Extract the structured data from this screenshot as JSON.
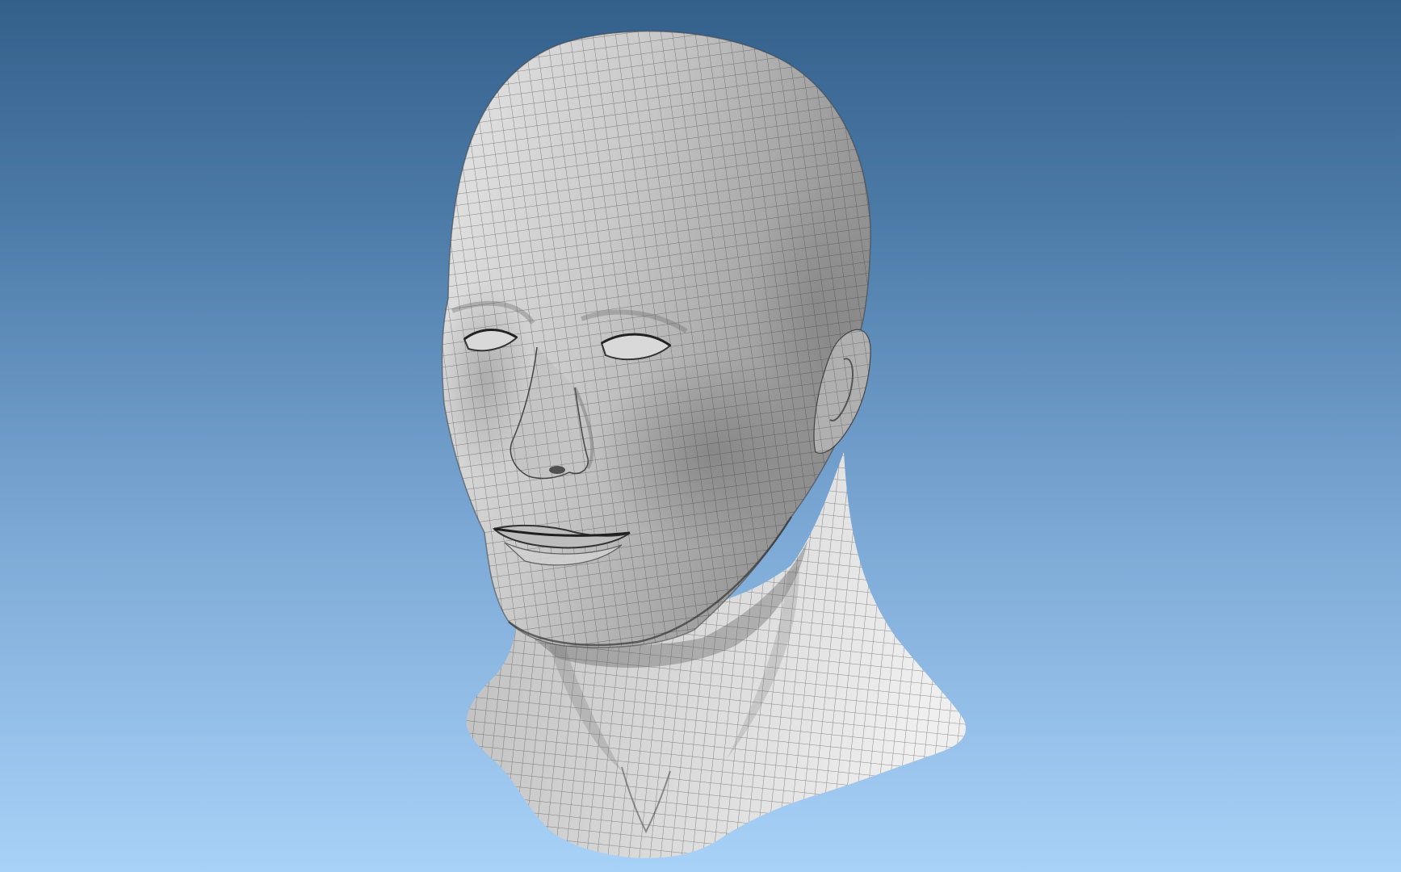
{
  "viewport": {
    "background_top": "#335f8b",
    "background_bottom": "#a9d2f8"
  },
  "model": {
    "subject": "male head bust",
    "render_style": "shaded gray with quad wireframe overlay",
    "surface_color": "#b9b9b9",
    "wire_color": "#3a3a3a"
  }
}
